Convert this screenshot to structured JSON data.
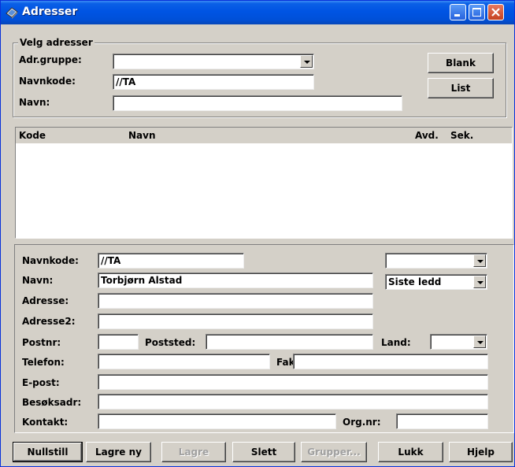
{
  "window": {
    "title": "Adresser",
    "icon": "book-icon",
    "controls": [
      "minimize-icon",
      "maximize-icon",
      "close-icon"
    ]
  },
  "select_group": {
    "title": "Velg adresser",
    "adr_gruppe": {
      "label": "Adr.gruppe:",
      "value": ""
    },
    "navnkode": {
      "label": "Navnkode:",
      "value": "//TA"
    },
    "navn": {
      "label": "Navn:",
      "value": ""
    },
    "blank_button": "Blank",
    "list_button": "List"
  },
  "results_list": {
    "columns": [
      "Kode",
      "Navn",
      "Avd.",
      "Sek."
    ],
    "rows": []
  },
  "detail": {
    "navnkode": {
      "label": "Navnkode:",
      "value": "//TA"
    },
    "navn": {
      "label": "Navn:",
      "value": "Torbjørn Alstad"
    },
    "adresse": {
      "label": "Adresse:",
      "value": ""
    },
    "adresse2": {
      "label": "Adresse2:",
      "value": ""
    },
    "postnr": {
      "label": "Postnr:",
      "value": ""
    },
    "poststed": {
      "label": "Poststed:",
      "value": ""
    },
    "land": {
      "label": "Land:",
      "value": ""
    },
    "telefon": {
      "label": "Telefon:",
      "value": ""
    },
    "faks": {
      "label": "Faks:",
      "value": ""
    },
    "epost": {
      "label": "E-post:",
      "value": ""
    },
    "besoksadr": {
      "label": "Besøksadr:",
      "value": ""
    },
    "kontakt": {
      "label": "Kontakt:",
      "value": ""
    },
    "orgnr": {
      "label": "Org.nr:",
      "value": ""
    },
    "type_select": {
      "value": ""
    },
    "ledd_select": {
      "value": "Siste ledd"
    }
  },
  "buttons": {
    "nullstill": "Nullstill",
    "lagre_ny": "Lagre ny",
    "lagre": "Lagre",
    "slett": "Slett",
    "grupper": "Grupper...",
    "lukk": "Lukk",
    "hjelp": "Hjelp"
  },
  "colors": {
    "titlebar": "#0054e3",
    "face": "#d4d0c8",
    "close": "#c5411f"
  }
}
